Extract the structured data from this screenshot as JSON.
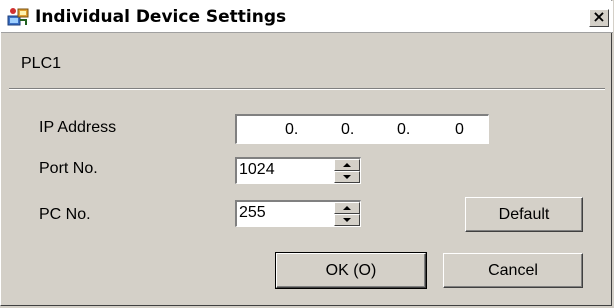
{
  "window": {
    "title": "Individual Device Settings",
    "close_label": "×"
  },
  "device": {
    "name": "PLC1"
  },
  "fields": {
    "ip_address": {
      "label": "IP Address",
      "octets": [
        "0.",
        "0.",
        "0.",
        "0"
      ]
    },
    "port": {
      "label": "Port No.",
      "value": "1024"
    },
    "pc_no": {
      "label": "PC No.",
      "value": "255"
    }
  },
  "buttons": {
    "default_label": "Default",
    "ok_label": "OK (O)",
    "ok_underline": "O",
    "cancel_label": "Cancel"
  },
  "colors": {
    "window_bg": "#d4d0c8",
    "title_bg": "#ffffff"
  }
}
